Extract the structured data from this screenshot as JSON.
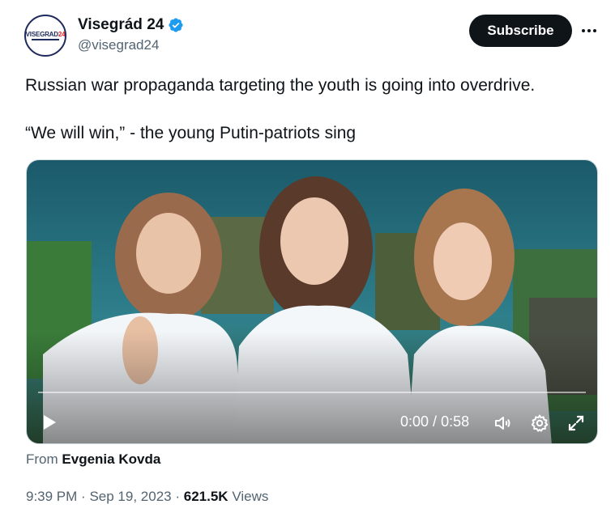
{
  "author": {
    "name": "Visegrád 24",
    "handle": "@visegrad24",
    "avatar_text": "VISEGRAD",
    "avatar_text_num": "24",
    "verified": true,
    "verified_color": "#1d9bf0"
  },
  "actions": {
    "subscribe_label": "Subscribe",
    "more_icon": "more-horizontal-icon"
  },
  "tweet": {
    "line1": "Russian war propaganda targeting the youth is going into overdrive.",
    "line2": "“We will win,” - the young Putin-patriots sing"
  },
  "video": {
    "current_time": "0:00",
    "separator": " / ",
    "duration": "0:58",
    "progress": 0,
    "controls": [
      "play-icon",
      "volume-icon",
      "settings-gear-icon",
      "fullscreen-icon"
    ]
  },
  "source": {
    "prefix": "From",
    "name": "Evgenia Kovda"
  },
  "meta": {
    "time": "9:39 PM",
    "date": "Sep 19, 2023",
    "views_count": "621.5K",
    "views_label": "Views",
    "dot": "·"
  },
  "colors": {
    "text_primary": "#0f1419",
    "text_secondary": "#536471",
    "subscribe_bg": "#0f1419",
    "border": "#cfd9de"
  }
}
